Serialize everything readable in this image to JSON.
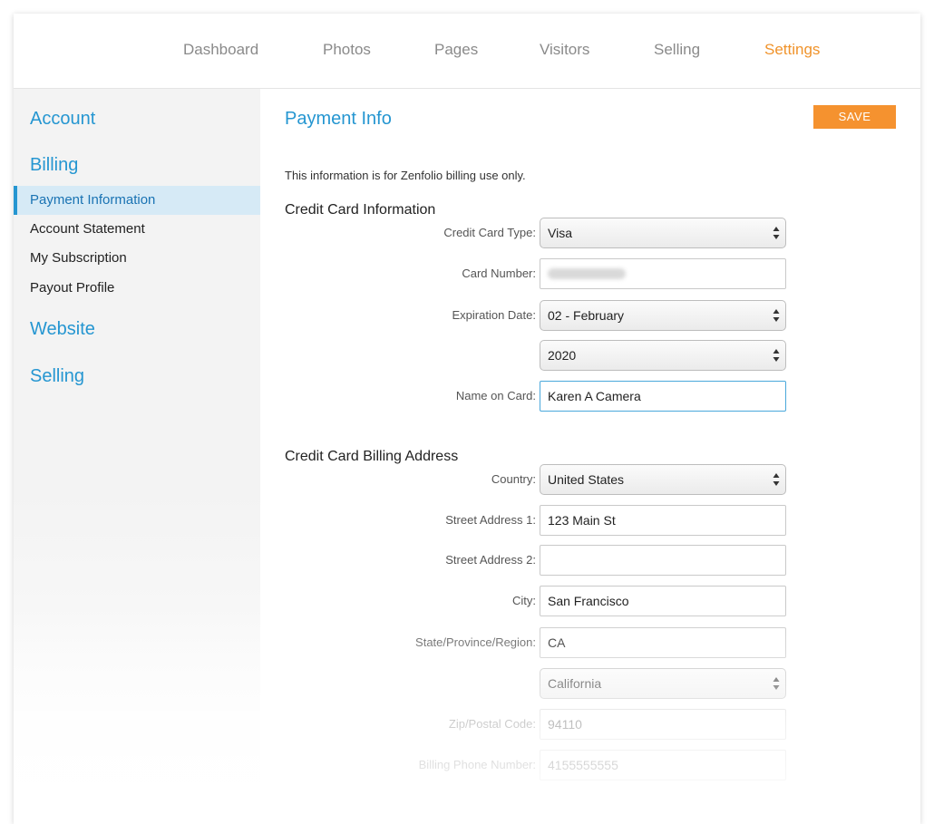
{
  "nav": {
    "items": [
      {
        "label": "Dashboard"
      },
      {
        "label": "Photos"
      },
      {
        "label": "Pages"
      },
      {
        "label": "Visitors"
      },
      {
        "label": "Selling"
      },
      {
        "label": "Settings",
        "active": true
      }
    ]
  },
  "sidebar": {
    "account": "Account",
    "billing": "Billing",
    "billing_items": [
      {
        "label": "Payment Information",
        "active": true
      },
      {
        "label": "Account Statement"
      },
      {
        "label": "My Subscription"
      },
      {
        "label": "Payout Profile"
      }
    ],
    "website": "Website",
    "selling": "Selling"
  },
  "main": {
    "title": "Payment Info",
    "save_label": "SAVE",
    "intro": "This information is for Zenfolio billing use only.",
    "cc_heading": "Credit Card Information",
    "cc": {
      "type_label": "Credit Card Type:",
      "type_value": "Visa",
      "number_label": "Card Number:",
      "exp_label": "Expiration Date:",
      "exp_month": "02 - February",
      "exp_year": "2020",
      "name_label": "Name on Card:",
      "name_value": "Karen A Camera"
    },
    "addr_heading": "Credit Card Billing Address",
    "addr": {
      "country_label": "Country:",
      "country_value": "United States",
      "street1_label": "Street Address 1:",
      "street1_value": "123 Main St",
      "street2_label": "Street Address 2:",
      "street2_value": "",
      "city_label": "City:",
      "city_value": "San Francisco",
      "state_label": "State/Province/Region:",
      "state_value": "CA",
      "state_select": "California",
      "zip_label": "Zip/Postal Code:",
      "zip_value": "94110",
      "phone_label": "Billing Phone Number:",
      "phone_value": "4155555555"
    }
  },
  "colors": {
    "accent_blue": "#2596d1",
    "accent_orange": "#f5922f"
  }
}
